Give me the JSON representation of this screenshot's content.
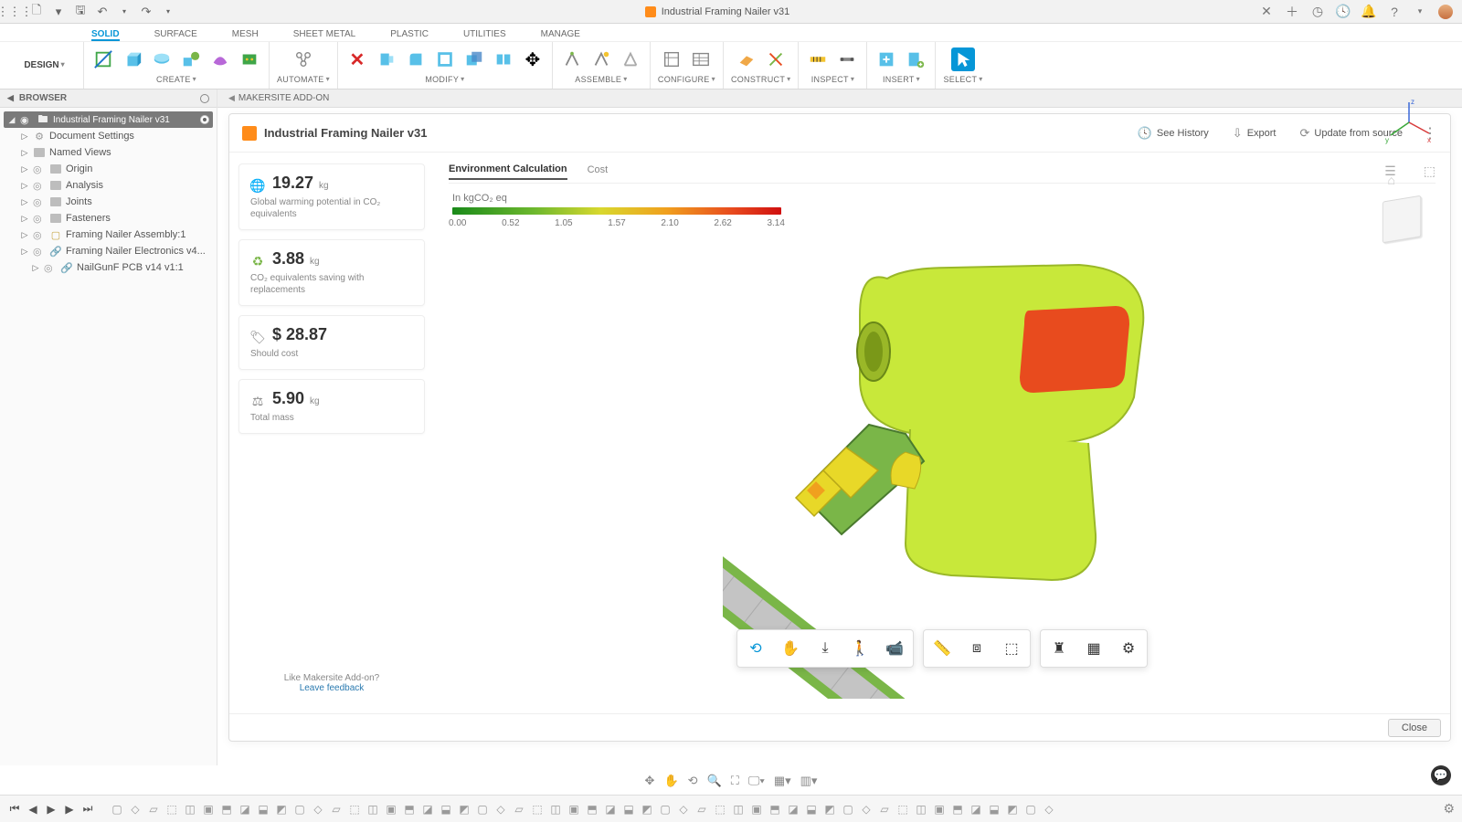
{
  "titlebar": {
    "title": "Industrial Framing Nailer v31"
  },
  "ribbon": {
    "design_label": "DESIGN",
    "tabs": [
      "SOLID",
      "SURFACE",
      "MESH",
      "SHEET METAL",
      "PLASTIC",
      "UTILITIES",
      "MANAGE"
    ],
    "active_tab": 0,
    "groups": {
      "create": "CREATE",
      "automate": "AUTOMATE",
      "modify": "MODIFY",
      "assemble": "ASSEMBLE",
      "configure": "CONFIGURE",
      "construct": "CONSTRUCT",
      "inspect": "INSPECT",
      "insert": "INSERT",
      "select": "SELECT"
    }
  },
  "browser": {
    "title": "BROWSER",
    "root": "Industrial Framing Nailer v31",
    "items": [
      {
        "label": "Document Settings",
        "icon": "gear"
      },
      {
        "label": "Named Views",
        "icon": "folder"
      },
      {
        "label": "Origin",
        "icon": "folder"
      },
      {
        "label": "Analysis",
        "icon": "folder"
      },
      {
        "label": "Joints",
        "icon": "folder"
      },
      {
        "label": "Fasteners",
        "icon": "folder"
      },
      {
        "label": "Framing Nailer Assembly:1",
        "icon": "comp"
      },
      {
        "label": "Framing Nailer Electronics v4...",
        "icon": "link"
      },
      {
        "label": "NailGunF PCB v14 v1:1",
        "icon": "link"
      }
    ]
  },
  "workspace": {
    "tab": "MAKERSITE ADD-ON"
  },
  "panel": {
    "title": "Industrial Framing Nailer v31",
    "actions": {
      "history": "See History",
      "export": "Export",
      "update": "Update from source"
    },
    "close": "Close"
  },
  "stats": [
    {
      "icon": "globe",
      "value": "19.27",
      "unit": "kg",
      "desc": "Global warming potential in CO₂ equivalents"
    },
    {
      "icon": "leaf",
      "value": "3.88",
      "unit": "kg",
      "desc": "CO₂ equivalents saving with replacements"
    },
    {
      "icon": "tag",
      "value": "$ 28.87",
      "unit": "",
      "desc": "Should cost"
    },
    {
      "icon": "weight",
      "value": "5.90",
      "unit": "kg",
      "desc": "Total mass"
    }
  ],
  "feedback": {
    "line1": "Like Makersite Add-on?",
    "line2": "Leave feedback"
  },
  "subtabs": {
    "env": "Environment Calculation",
    "cost": "Cost"
  },
  "chart_data": {
    "type": "bar",
    "title": "In kgCO₂ eq",
    "categories": [
      "0.00",
      "0.52",
      "1.05",
      "1.57",
      "2.10",
      "2.62",
      "3.14"
    ],
    "values": [
      0.0,
      0.52,
      1.05,
      1.57,
      2.1,
      2.62,
      3.14
    ],
    "range": [
      0.0,
      3.14
    ],
    "gradient": [
      "#1a8a1a",
      "#6db82e",
      "#d8d82e",
      "#f0a01e",
      "#e84b1e",
      "#d01010"
    ]
  }
}
